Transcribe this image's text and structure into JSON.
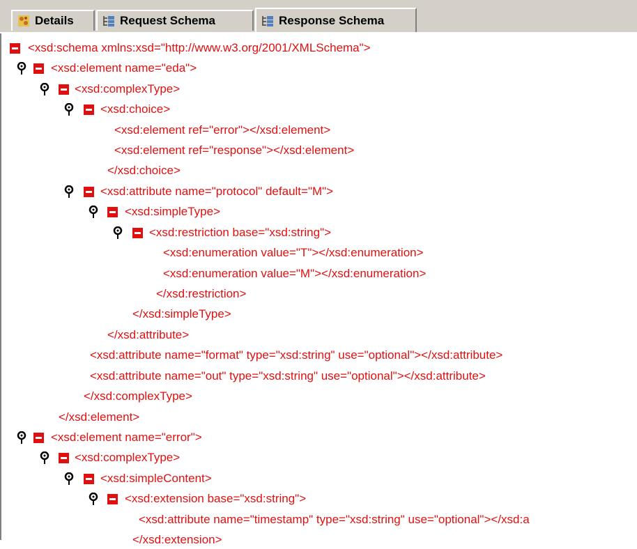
{
  "tabs": [
    {
      "label": "Details",
      "icon": "details-icon"
    },
    {
      "label": "Request Schema",
      "icon": "schema-tree-icon"
    },
    {
      "label": "Response Schema",
      "icon": "schema-tree-icon"
    }
  ],
  "active_tab": "Response Schema",
  "colors": {
    "text": "#e01010",
    "tab_bg": "#d4d0c8"
  },
  "tree": {
    "lines": [
      "<xsd:schema xmlns:xsd=\"http://www.w3.org/2001/XMLSchema\">",
      "<xsd:element name=\"eda\">",
      "<xsd:complexType>",
      "<xsd:choice>",
      "<xsd:element ref=\"error\"></xsd:element>",
      "<xsd:element ref=\"response\"></xsd:element>",
      "</xsd:choice>",
      "<xsd:attribute name=\"protocol\" default=\"M\">",
      "<xsd:simpleType>",
      "<xsd:restriction base=\"xsd:string\">",
      "<xsd:enumeration value=\"T\"></xsd:enumeration>",
      "<xsd:enumeration value=\"M\"></xsd:enumeration>",
      "</xsd:restriction>",
      "</xsd:simpleType>",
      "</xsd:attribute>",
      "<xsd:attribute name=\"format\" type=\"xsd:string\" use=\"optional\"></xsd:attribute>",
      "<xsd:attribute name=\"out\" type=\"xsd:string\" use=\"optional\"></xsd:attribute>",
      "</xsd:complexType>",
      "</xsd:element>",
      "<xsd:element name=\"error\">",
      "<xsd:complexType>",
      "<xsd:simpleContent>",
      "<xsd:extension base=\"xsd:string\">",
      "<xsd:attribute name=\"timestamp\" type=\"xsd:string\" use=\"optional\"></xsd:a",
      "</xsd:extension>"
    ]
  }
}
